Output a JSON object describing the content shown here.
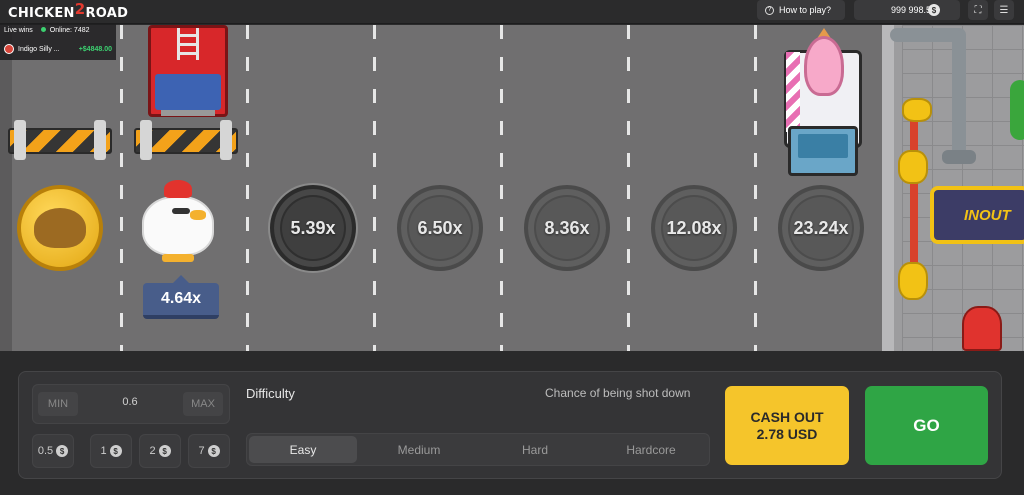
{
  "header": {
    "logo_left": "CHICKEN",
    "logo_num": "2",
    "logo_right": "ROAD",
    "how_to_play": "How to play?",
    "balance": "999 998.59",
    "currency_symbol": "$"
  },
  "live_wins": {
    "title": "Live wins",
    "online_label": "Online: 7482",
    "entries": [
      {
        "user": "Indigo Silly ...",
        "amount": "+$4848.00"
      }
    ]
  },
  "game": {
    "current_multiplier": "4.64x",
    "multipliers": [
      "5.39x",
      "6.50x",
      "8.36x",
      "12.08x",
      "23.24x"
    ],
    "sign_text": "INOUT"
  },
  "controls": {
    "min_label": "MIN",
    "max_label": "MAX",
    "bet_value": "0.6",
    "quick_bets": [
      "0.5",
      "1",
      "2",
      "7"
    ],
    "difficulty_label": "Difficulty",
    "chance_label": "Chance of being shot down",
    "difficulties": [
      "Easy",
      "Medium",
      "Hard",
      "Hardcore"
    ],
    "selected_difficulty": "Easy",
    "cashout_label": "CASH OUT",
    "cashout_amount": "2.78 USD",
    "go_label": "GO"
  }
}
